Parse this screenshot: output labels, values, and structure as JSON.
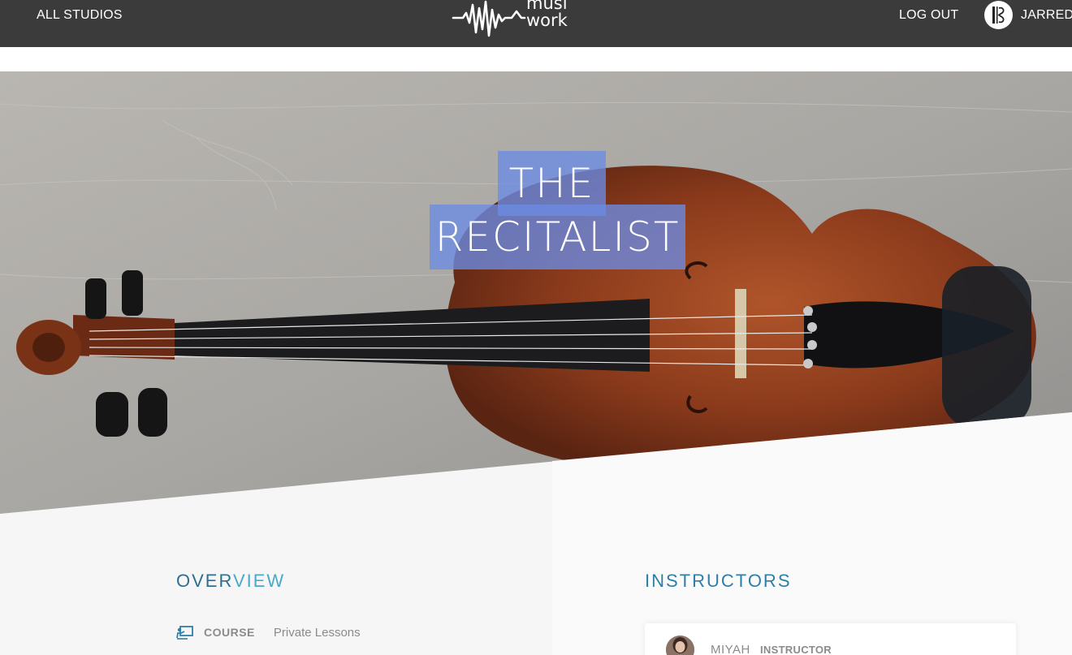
{
  "nav": {
    "all_studios": "ALL STUDIOS",
    "logo_line1": "musi",
    "logo_line2": "work",
    "logout": "LOG OUT",
    "user_name": "JARRED"
  },
  "hero": {
    "title_line1": "THE",
    "title_line2": "RECITALIST"
  },
  "overview": {
    "title_part1": "OVER",
    "title_part2": "VIEW",
    "course_label": "COURSE",
    "course_value": "Private Lessons"
  },
  "instructors": {
    "title": "INSTRUCTORS",
    "items": [
      {
        "name": "MIYAH",
        "role": "INSTRUCTOR"
      }
    ]
  },
  "colors": {
    "topbar": "#3b3b3b",
    "accent_blue": "#2e7fa6",
    "accent_light": "#4aa8c9",
    "title_highlight": "#6c8ce4"
  }
}
